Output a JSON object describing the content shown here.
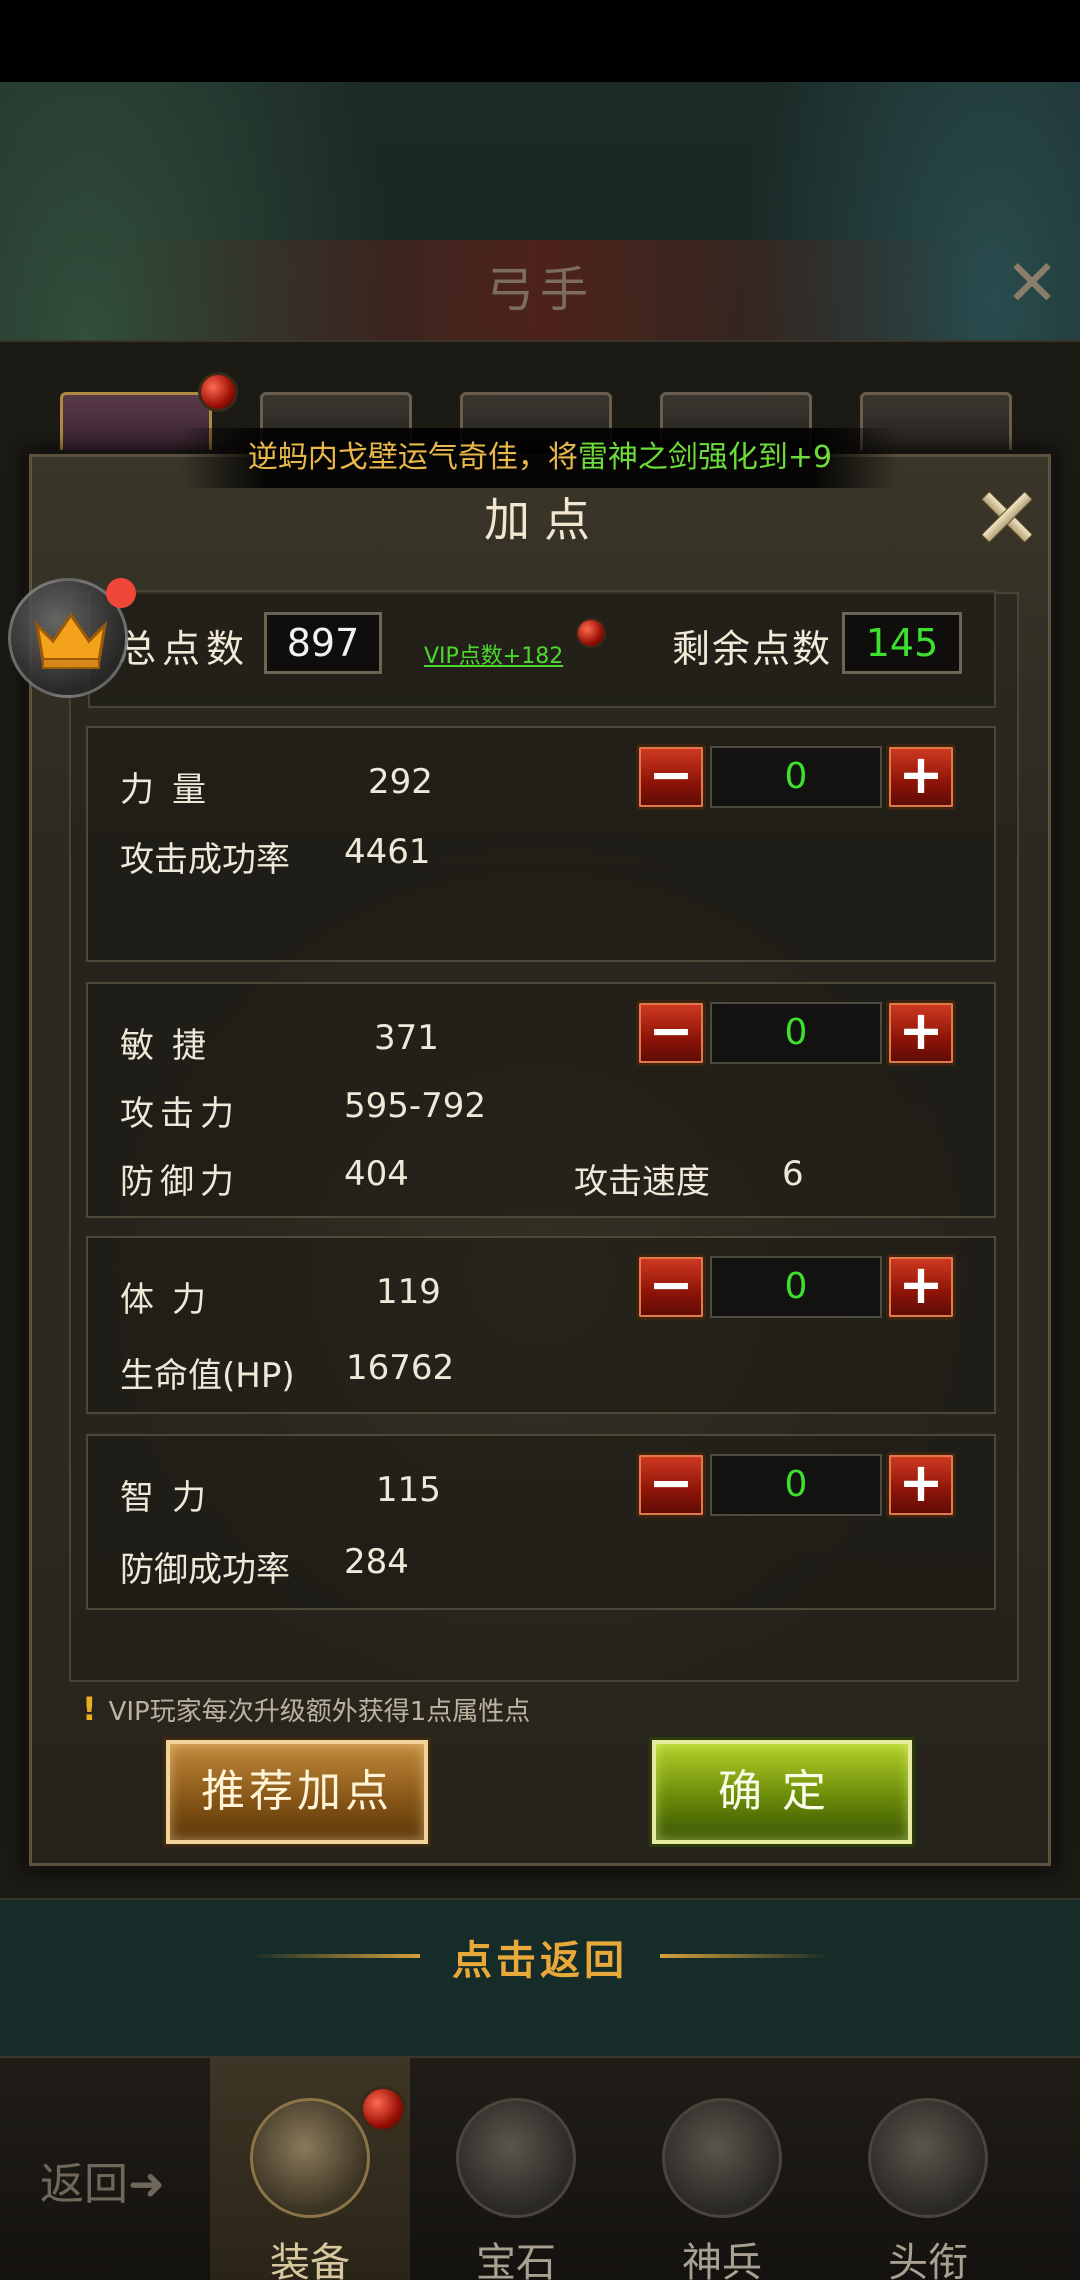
{
  "background": {
    "title": "弓手"
  },
  "notice": {
    "prefix": "逆蚂内戈壁运气奇佳，将",
    "item": "雷神之剑强化到",
    "level": "+9"
  },
  "dialog": {
    "title": "加点",
    "total_label": "总点数",
    "total_value": "897",
    "vip_link": "VIP点数+182",
    "remaining_label": "剩余点数",
    "remaining_value": "145"
  },
  "attributes": [
    {
      "name": "力量",
      "value": "292",
      "allocated": "0",
      "stats": [
        {
          "label": "攻击成功率",
          "value": "4461"
        }
      ]
    },
    {
      "name": "敏捷",
      "value": "371",
      "allocated": "0",
      "stats": [
        {
          "label": "攻击力",
          "value": "595-792"
        },
        {
          "label": "防御力",
          "value": "404"
        },
        {
          "label": "攻击速度",
          "value": "6"
        }
      ]
    },
    {
      "name": "体力",
      "value": "119",
      "allocated": "0",
      "stats": [
        {
          "label": "生命值(HP)",
          "value": "16762"
        }
      ]
    },
    {
      "name": "智力",
      "value": "115",
      "allocated": "0",
      "stats": [
        {
          "label": "防御成功率",
          "value": "284"
        }
      ]
    }
  ],
  "tip": "VIP玩家每次升级额外获得1点属性点",
  "buttons": {
    "recommend": "推荐加点",
    "confirm": "确定"
  },
  "return_text": "点击返回",
  "bottom_nav": {
    "back": "返回",
    "tabs": [
      "装备",
      "宝石",
      "神兵",
      "头衔"
    ],
    "active_tab": "装备"
  },
  "colors": {
    "accent_gold": "#e8b84a",
    "value_green": "#3ee030",
    "stepper_red": "#b0200e",
    "confirm_green": "#8aac14"
  }
}
